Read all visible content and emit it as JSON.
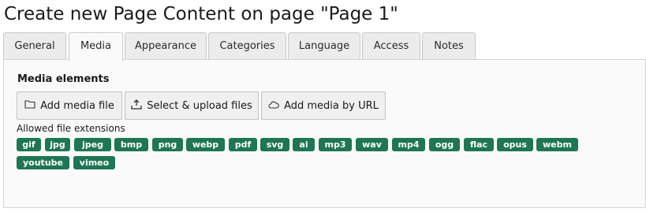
{
  "page_title": "Create new Page Content on page \"Page 1\"",
  "tabs": [
    {
      "label": "General",
      "active": false
    },
    {
      "label": "Media",
      "active": true
    },
    {
      "label": "Appearance",
      "active": false
    },
    {
      "label": "Categories",
      "active": false
    },
    {
      "label": "Language",
      "active": false
    },
    {
      "label": "Access",
      "active": false
    },
    {
      "label": "Notes",
      "active": false
    }
  ],
  "media": {
    "section_label": "Media elements",
    "buttons": {
      "add_media_file": {
        "label": "Add media file",
        "icon": "folder-icon"
      },
      "select_upload": {
        "label": "Select & upload files",
        "icon": "upload-icon"
      },
      "add_by_url": {
        "label": "Add media by URL",
        "icon": "cloud-icon"
      }
    },
    "allowed_label": "Allowed file extensions",
    "extensions": [
      "gif",
      "jpg",
      "jpeg",
      "bmp",
      "png",
      "webp",
      "pdf",
      "svg",
      "ai",
      "mp3",
      "wav",
      "mp4",
      "ogg",
      "flac",
      "opus",
      "webm",
      "youtube",
      "vimeo"
    ]
  },
  "colors": {
    "badge": "#1e7654",
    "badge_text": "#ffffff",
    "tab_bg": "#ececec",
    "panel_bg": "#fafafa"
  }
}
